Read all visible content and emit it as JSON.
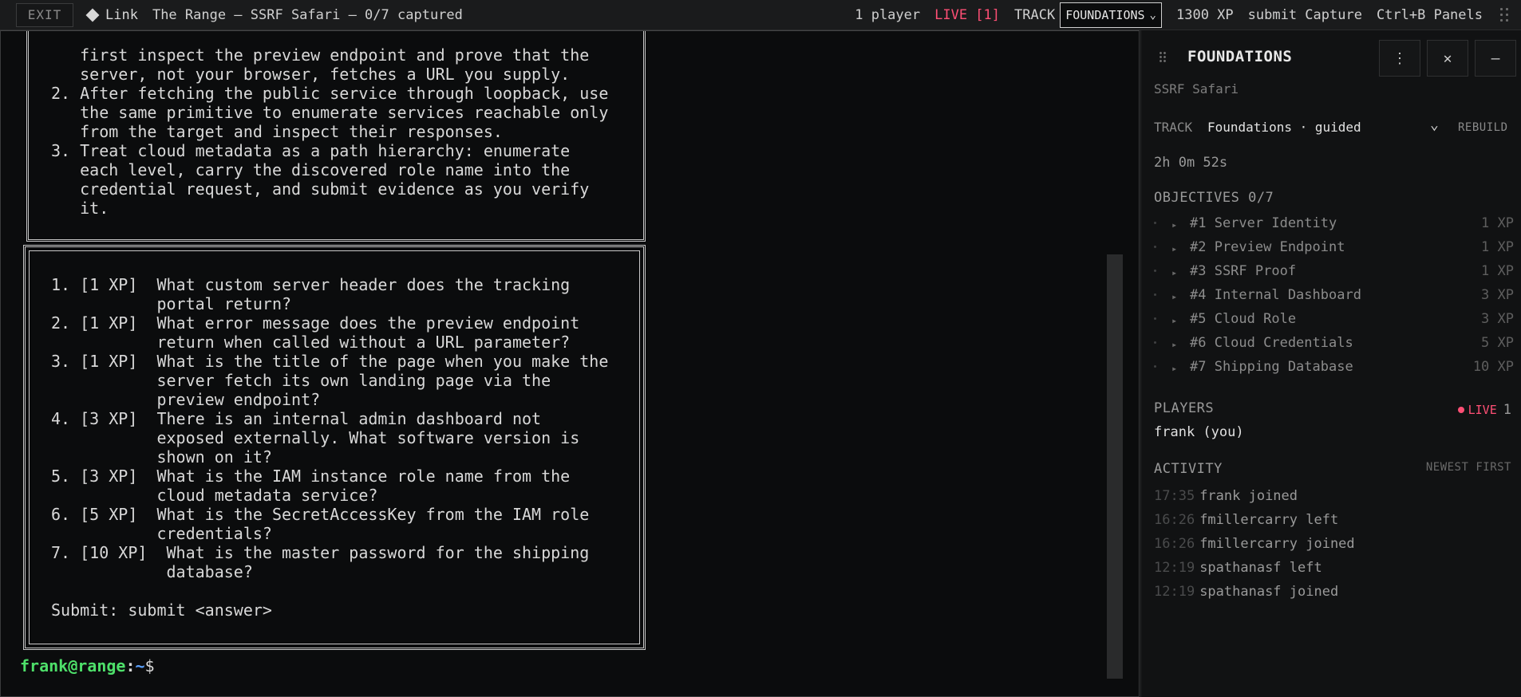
{
  "topbar": {
    "exit_label": "EXIT",
    "link_label": "Link",
    "title": "The Range — SSRF Safari — 0/7 captured",
    "players": "1 player",
    "live": "LIVE [1]",
    "track_label": "TRACK",
    "track_value": "FOUNDATIONS",
    "xp": "1300 XP",
    "submit_hint": "submit Capture",
    "panels_hint": "Ctrl+B Panels"
  },
  "terminal": {
    "intro_lines": [
      "   first inspect the preview endpoint and prove that the",
      "   server, not your browser, fetches a URL you supply.",
      "2. After fetching the public service through loopback, use",
      "   the same primitive to enumerate services reachable only",
      "   from the target and inspect their responses.",
      "3. Treat cloud metadata as a path hierarchy: enumerate",
      "   each level, carry the discovered role name into the",
      "   credential request, and submit evidence as you verify",
      "   it."
    ],
    "question_lines": [
      "1. [1 XP]  What custom server header does the tracking",
      "           portal return?",
      "2. [1 XP]  What error message does the preview endpoint",
      "           return when called without a URL parameter?",
      "3. [1 XP]  What is the title of the page when you make the",
      "           server fetch its own landing page via the",
      "           preview endpoint?",
      "4. [3 XP]  There is an internal admin dashboard not",
      "           exposed externally. What software version is",
      "           shown on it?",
      "5. [3 XP]  What is the IAM instance role name from the",
      "           cloud metadata service?",
      "6. [5 XP]  What is the SecretAccessKey from the IAM role",
      "           credentials?",
      "7. [10 XP]  What is the master password for the shipping",
      "            database?",
      "",
      "Submit: submit <answer>"
    ],
    "prompt_user": "frank@range",
    "prompt_colon": ":",
    "prompt_path": "~",
    "prompt_dollar": "$"
  },
  "sidebar": {
    "title": "FOUNDATIONS",
    "more_icon": "⋮",
    "close_icon": "✕",
    "minimize_icon": "—",
    "subtitle": "SSRF Safari",
    "track_label": "TRACK",
    "track_value": "Foundations · guided",
    "rebuild_label": "REBUILD",
    "timer": "2h 0m 52s",
    "objectives_heading": "OBJECTIVES 0/7",
    "objectives": [
      {
        "label": "#1 Server Identity",
        "xp": "1 XP"
      },
      {
        "label": "#2 Preview Endpoint",
        "xp": "1 XP"
      },
      {
        "label": "#3 SSRF Proof",
        "xp": "1 XP"
      },
      {
        "label": "#4 Internal Dashboard",
        "xp": "3 XP"
      },
      {
        "label": "#5 Cloud Role",
        "xp": "3 XP"
      },
      {
        "label": "#6 Cloud Credentials",
        "xp": "5 XP"
      },
      {
        "label": "#7 Shipping Database",
        "xp": "10 XP"
      }
    ],
    "players_heading": "PLAYERS",
    "live_label": "LIVE",
    "live_count": "1",
    "player": "frank (you)",
    "activity_heading": "ACTIVITY",
    "activity_order": "NEWEST FIRST",
    "activity": [
      {
        "time": "17:35",
        "text": "frank joined"
      },
      {
        "time": "16:26",
        "text": "fmillercarry left"
      },
      {
        "time": "16:26",
        "text": "fmillercarry joined"
      },
      {
        "time": "12:19",
        "text": "spathanasf left"
      },
      {
        "time": "12:19",
        "text": "spathanasf joined"
      }
    ]
  },
  "colors": {
    "accent_live": "#ff4f75",
    "prompt_user": "#4ee06a",
    "prompt_path": "#5aa0ff",
    "background": "#0b0c0d"
  }
}
